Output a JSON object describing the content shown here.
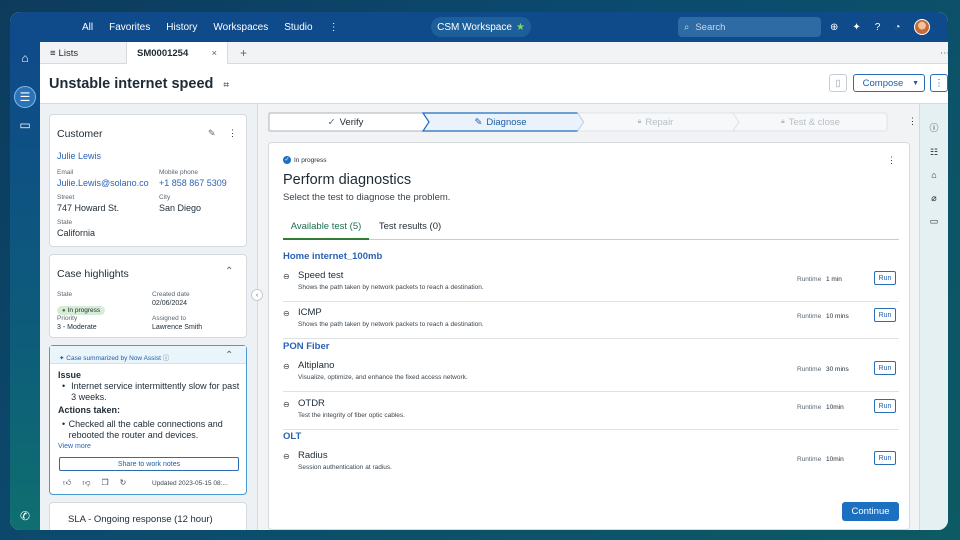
{
  "topbar": {
    "nav": [
      "All",
      "Favorites",
      "History",
      "Workspaces",
      "Studio"
    ],
    "workspace": "CSM Workspace",
    "search_placeholder": "Search"
  },
  "tabs": {
    "lists": "Lists",
    "record": "SM0001254"
  },
  "header": {
    "title": "Unstable internet speed",
    "compose": "Compose"
  },
  "customer": {
    "heading": "Customer",
    "name": "Julie Lewis",
    "email_label": "Email",
    "email": "Julie.Lewis@solano.co",
    "mobile_label": "Mobile phone",
    "mobile": "+1 858 867 5309",
    "street_label": "Street",
    "street": "747 Howard St.",
    "city_label": "City",
    "city": "San Diego",
    "state_label": "State",
    "state": "California"
  },
  "highlights": {
    "heading": "Case highlights",
    "state_label": "State",
    "state": "In progress",
    "created_label": "Created date",
    "created": "02/06/2024",
    "priority_label": "Priority",
    "priority": "3 - Moderate",
    "assigned_label": "Assigned to",
    "assigned": "Lawrence Smith"
  },
  "summary": {
    "heading": "Case summarized by Now Assist",
    "issue_label": "Issue",
    "issue": "Internet service intermittently slow for past 3 weeks.",
    "actions_label": "Actions taken:",
    "action": "Checked all the cable connections and rebooted the router and devices.",
    "view_more": "View more",
    "share": "Share to work notes",
    "updated": "Updated 2023-05-15 08:..."
  },
  "sla": {
    "label": "SLA - Ongoing response (12 hour)"
  },
  "stepper": {
    "steps": [
      "Verify",
      "Diagnose",
      "Repair",
      "Test & close"
    ]
  },
  "diagnostics": {
    "status": "In progress",
    "title": "Perform diagnostics",
    "subtitle": "Select the test to diagnose the problem.",
    "tab_available": "Available test (5)",
    "tab_results": "Test results (0)",
    "runtime_label": "Runtime",
    "run_label": "Run",
    "continue": "Continue",
    "sections": [
      {
        "title": "Home internet_100mb",
        "tests": [
          {
            "name": "Speed test",
            "desc": "Shows the path taken by network packets to reach a destination.",
            "runtime": "1 min"
          },
          {
            "name": "ICMP",
            "desc": "Shows the path taken by network packets to reach a destination.",
            "runtime": "10 mins"
          }
        ]
      },
      {
        "title": "PON Fiber",
        "tests": [
          {
            "name": "Altiplano",
            "desc": "Visualize, optimize, and enhance the fixed access network.",
            "runtime": "30 mins"
          },
          {
            "name": "OTDR",
            "desc": "Test the integrity of fiber optic cables.",
            "runtime": "10min"
          }
        ]
      },
      {
        "title": "OLT",
        "tests": [
          {
            "name": "Radius",
            "desc": "Session authentication at radius.",
            "runtime": "10min"
          }
        ]
      }
    ]
  },
  "colors": {
    "brand": "#0f4a8a",
    "accent": "#1d6fc0",
    "status_green": "#2f7d32"
  }
}
